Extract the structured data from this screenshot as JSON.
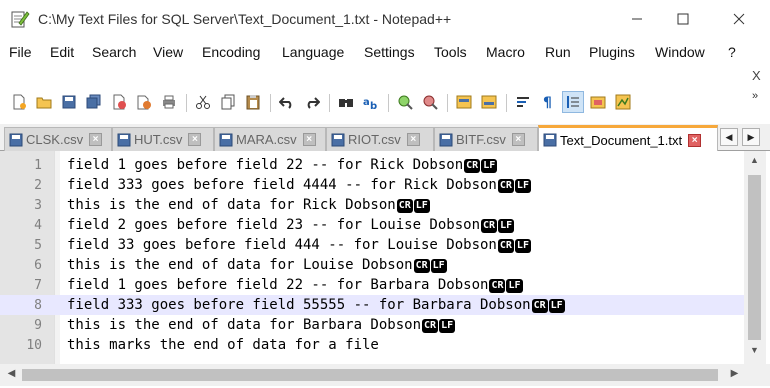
{
  "window": {
    "title": "C:\\My Text Files for SQL Server\\Text_Document_1.txt - Notepad++"
  },
  "menu": [
    {
      "label": "File"
    },
    {
      "label": "Edit"
    },
    {
      "label": "Search"
    },
    {
      "label": "View"
    },
    {
      "label": "Encoding"
    },
    {
      "label": "Language"
    },
    {
      "label": "Settings"
    },
    {
      "label": "Tools"
    },
    {
      "label": "Macro"
    },
    {
      "label": "Run"
    },
    {
      "label": "Plugins"
    },
    {
      "label": "Window"
    },
    {
      "label": "?"
    }
  ],
  "menu_close": "X",
  "toolbar_more": "»",
  "tabs": [
    {
      "label": "CLSK.csv",
      "active": false
    },
    {
      "label": "HUT.csv",
      "active": false
    },
    {
      "label": "MARA.csv",
      "active": false
    },
    {
      "label": "RIOT.csv",
      "active": false
    },
    {
      "label": "BITF.csv",
      "active": false
    },
    {
      "label": "Text_Document_1.txt",
      "active": true
    }
  ],
  "eol": {
    "cr": "CR",
    "lf": "LF"
  },
  "editor": {
    "current_line": 8,
    "lines": [
      {
        "num": "1",
        "text": "field 1 goes before field 22 -- for Rick Dobson",
        "eol": true
      },
      {
        "num": "2",
        "text": "field 333 goes before field 4444 -- for Rick Dobson",
        "eol": true
      },
      {
        "num": "3",
        "text": "this is the end of data for Rick Dobson",
        "eol": true
      },
      {
        "num": "4",
        "text": "field 2 goes before field 23 -- for Louise Dobson",
        "eol": true
      },
      {
        "num": "5",
        "text": "field 33 goes before field 444 -- for Louise Dobson",
        "eol": true
      },
      {
        "num": "6",
        "text": "this is the end of data for Louise Dobson",
        "eol": true
      },
      {
        "num": "7",
        "text": "field 1 goes before field 22 -- for Barbara Dobson",
        "eol": true
      },
      {
        "num": "8",
        "text": "field 333 goes before field 55555 -- for Barbara Dobson",
        "eol": true
      },
      {
        "num": "9",
        "text": "this is the end of data for Barbara Dobson",
        "eol": true
      },
      {
        "num": "10",
        "text": "this marks the end of data for a file",
        "eol": false
      }
    ]
  }
}
